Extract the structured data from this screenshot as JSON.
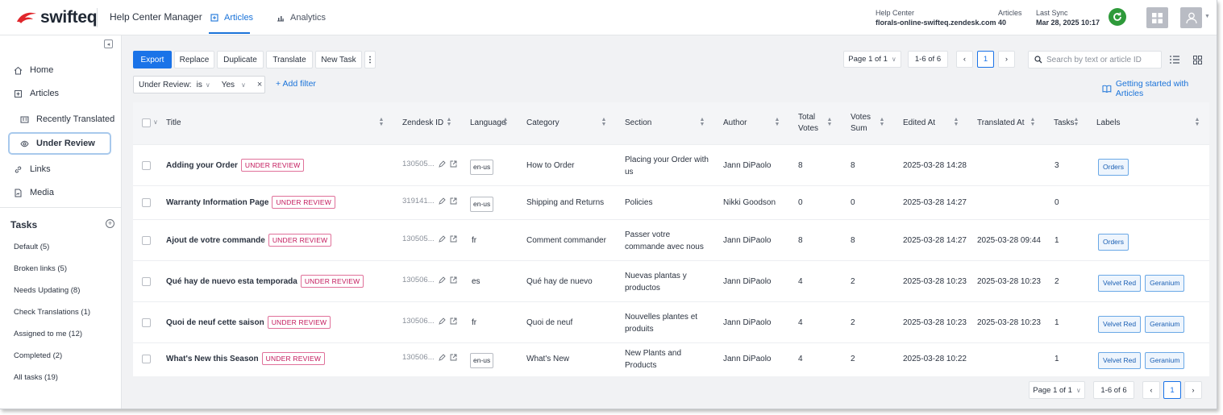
{
  "header": {
    "logo_text": "swifteq",
    "app_name": "Help Center Manager",
    "tabs": [
      {
        "label": "Articles",
        "icon": "articles-icon"
      },
      {
        "label": "Analytics",
        "icon": "chart-icon"
      }
    ],
    "help_center_label": "Help Center",
    "help_center_value": "florals-online-swifteq.zendesk.com",
    "articles_label": "Articles",
    "articles_value": "40",
    "last_sync_label": "Last Sync",
    "last_sync_value": "Mar 28, 2025 10:17"
  },
  "sidebar": {
    "items": [
      {
        "label": "Home",
        "icon": "home-icon"
      },
      {
        "label": "Articles",
        "icon": "articles-icon"
      },
      {
        "label": "Recently Translated",
        "icon": "translate-icon"
      },
      {
        "label": "Under Review",
        "icon": "eye-icon"
      },
      {
        "label": "Links",
        "icon": "link-icon"
      },
      {
        "label": "Media",
        "icon": "media-icon"
      }
    ],
    "tasks_heading": "Tasks",
    "tasks": [
      "Default (5)",
      "Broken links (5)",
      "Needs Updating (8)",
      "Check Translations (1)",
      "Assigned to me (12)",
      "Completed (2)",
      "All tasks (19)"
    ]
  },
  "toolbar": {
    "buttons": [
      "Export",
      "Replace",
      "Duplicate",
      "Translate",
      "New Task"
    ],
    "more": "⋮",
    "page_select": "Page 1 of 1",
    "range": "1-6 of 6",
    "current_page": "1",
    "search_placeholder": "Search by text or article ID"
  },
  "filter": {
    "field": "Under Review:",
    "operator": "is",
    "value": "Yes",
    "add_filter": "+ Add filter",
    "getting_started": "Getting started with Articles"
  },
  "table": {
    "columns": [
      "Title",
      "Zendesk ID",
      "Language",
      "Category",
      "Section",
      "Author",
      "Total Votes",
      "Votes Sum",
      "Edited At",
      "Translated At",
      "Tasks",
      "Labels"
    ],
    "badge_text": "UNDER REVIEW",
    "rows": [
      {
        "title": "Adding your Order",
        "zid": "130505...",
        "lang": "en-us",
        "lang_tag": true,
        "category": "How to Order",
        "section": "Placing your Order with us",
        "author": "Jann DiPaolo",
        "total_votes": "8",
        "votes_sum": "8",
        "edited": "2025-03-28 14:28",
        "translated": "",
        "tasks": "3",
        "labels": [
          "Orders"
        ]
      },
      {
        "title": "Warranty Information Page",
        "zid": "319141...",
        "lang": "en-us",
        "lang_tag": true,
        "category": "Shipping and Returns",
        "section": "Policies",
        "author": "Nikki Goodson",
        "total_votes": "0",
        "votes_sum": "0",
        "edited": "2025-03-28 14:27",
        "translated": "",
        "tasks": "0",
        "labels": []
      },
      {
        "title": "Ajout de votre commande",
        "zid": "130505...",
        "lang": "fr",
        "lang_tag": false,
        "category": "Comment commander",
        "section": "Passer votre commande avec nous",
        "author": "Jann DiPaolo",
        "total_votes": "8",
        "votes_sum": "8",
        "edited": "2025-03-28 14:27",
        "translated": "2025-03-28 09:44",
        "tasks": "1",
        "labels": [
          "Orders"
        ]
      },
      {
        "title": "Qué hay de nuevo esta temporada",
        "zid": "130506...",
        "lang": "es",
        "lang_tag": false,
        "category": "Qué hay de nuevo",
        "section": "Nuevas plantas y productos",
        "author": "Jann DiPaolo",
        "total_votes": "4",
        "votes_sum": "2",
        "edited": "2025-03-28 10:23",
        "translated": "2025-03-28 10:23",
        "tasks": "2",
        "labels": [
          "Velvet Red",
          "Geranium"
        ]
      },
      {
        "title": "Quoi de neuf cette saison",
        "zid": "130506...",
        "lang": "fr",
        "lang_tag": false,
        "category": "Quoi de neuf",
        "section": "Nouvelles plantes et produits",
        "author": "Jann DiPaolo",
        "total_votes": "4",
        "votes_sum": "2",
        "edited": "2025-03-28 10:23",
        "translated": "2025-03-28 10:23",
        "tasks": "1",
        "labels": [
          "Velvet Red",
          "Geranium"
        ]
      },
      {
        "title": "What's New this Season",
        "zid": "130506...",
        "lang": "en-us",
        "lang_tag": true,
        "category": "What's New",
        "section": "New Plants and Products",
        "author": "Jann DiPaolo",
        "total_votes": "4",
        "votes_sum": "2",
        "edited": "2025-03-28 10:22",
        "translated": "",
        "tasks": "1",
        "labels": [
          "Velvet Red",
          "Geranium"
        ]
      }
    ]
  },
  "colors": {
    "accent": "#1a73e8",
    "badge": "#c2185b",
    "sync": "#2e9a3a",
    "logo_red": "#e0262b"
  }
}
